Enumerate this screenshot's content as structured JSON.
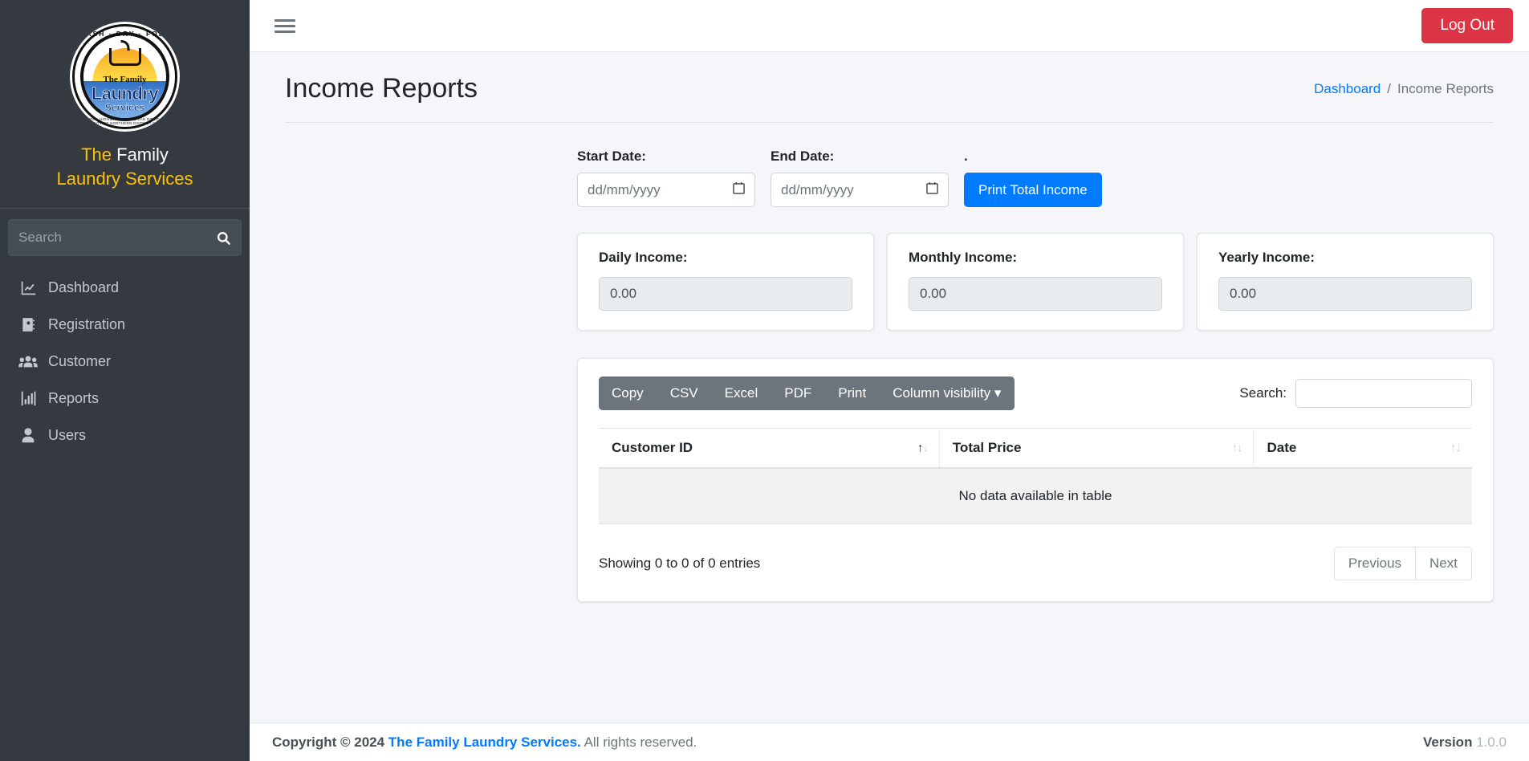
{
  "sidebar": {
    "logo": {
      "arc_top": "WASH · DRY · FOLD",
      "line1": "The Family",
      "line2": "Laundry",
      "line3": "Services",
      "arc_bottom": "NATIONAL HIGHWAY, VILLAGE SAN DIEGO CITY, UNIVERSITY OF NORTHERN DISTRICT COLLEGE"
    },
    "brand": {
      "accent": "The",
      "rest": "Family",
      "line2": "Laundry Services"
    },
    "search": {
      "placeholder": "Search",
      "value": "",
      "icon": "search-icon"
    },
    "items": [
      {
        "label": "Dashboard",
        "icon": "chart-line-icon"
      },
      {
        "label": "Registration",
        "icon": "address-book-icon"
      },
      {
        "label": "Customer",
        "icon": "users-icon"
      },
      {
        "label": "Reports",
        "icon": "chart-bar-icon"
      },
      {
        "label": "Users",
        "icon": "user-icon"
      }
    ]
  },
  "topbar": {
    "menu_icon": "hamburger-icon",
    "logout_label": "Log Out"
  },
  "page": {
    "title": "Income Reports",
    "breadcrumb": {
      "link": "Dashboard",
      "separator": "/",
      "current": "Income Reports"
    }
  },
  "filters": {
    "start_date": {
      "label": "Start Date:",
      "placeholder": "dd/mm/yyyy",
      "value": ""
    },
    "end_date": {
      "label": "End Date:",
      "placeholder": "dd/mm/yyyy",
      "value": ""
    },
    "print": {
      "label": ".",
      "button_label": "Print Total Income"
    }
  },
  "income_cards": [
    {
      "label": "Daily Income:",
      "value": "0.00"
    },
    {
      "label": "Monthly Income:",
      "value": "0.00"
    },
    {
      "label": "Yearly Income:",
      "value": "0.00"
    }
  ],
  "datatable": {
    "buttons": [
      "Copy",
      "CSV",
      "Excel",
      "PDF",
      "Print",
      "Column visibility"
    ],
    "column_visibility_caret": "▾",
    "search": {
      "label": "Search:",
      "value": "",
      "placeholder": ""
    },
    "columns": [
      {
        "label": "Customer ID",
        "sort": "asc"
      },
      {
        "label": "Total Price",
        "sort": "none"
      },
      {
        "label": "Date",
        "sort": "none"
      }
    ],
    "empty_message": "No data available in table",
    "info": "Showing 0 to 0 of 0 entries",
    "pagination": {
      "previous": "Previous",
      "next": "Next"
    }
  },
  "footer": {
    "copyright_prefix": "Copyright © 2024",
    "company": "The Family Laundry Services.",
    "rights": "All rights reserved.",
    "version_label": "Version",
    "version_number": "1.0.0"
  },
  "colors": {
    "sidebar_bg": "#343a40",
    "accent_yellow": "#ffc107",
    "primary_blue": "#007bff",
    "danger_red": "#dc3545",
    "secondary_gray": "#6c757d",
    "page_bg": "#f4f6f9"
  }
}
